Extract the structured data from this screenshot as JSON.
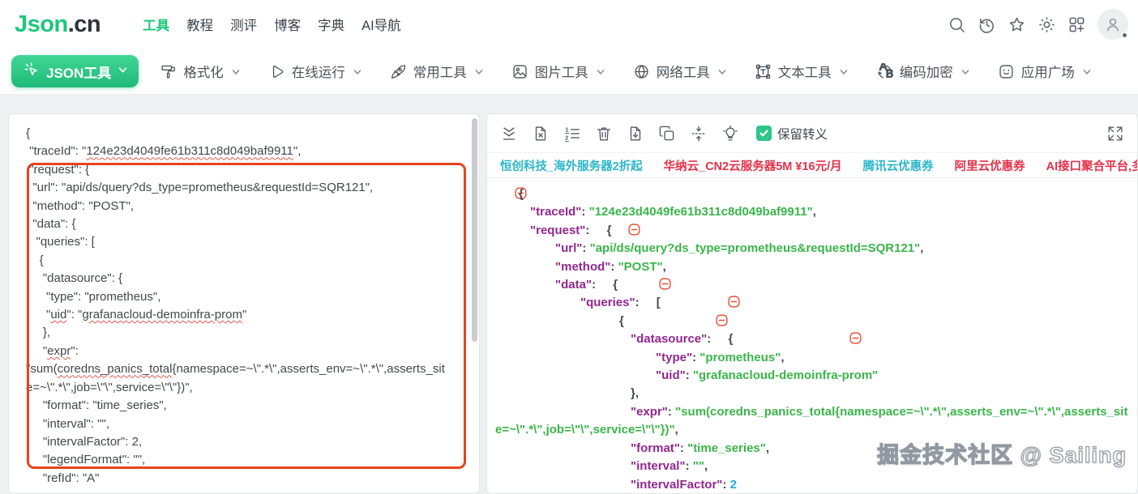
{
  "header": {
    "logo_part1": "Json",
    "logo_part2": ".cn",
    "nav": [
      {
        "label": "工具",
        "active": true
      },
      {
        "label": "教程",
        "active": false
      },
      {
        "label": "测评",
        "active": false
      },
      {
        "label": "博客",
        "active": false
      },
      {
        "label": "字典",
        "active": false
      },
      {
        "label": "AI导航",
        "active": false
      }
    ],
    "right_icons": [
      "search-icon",
      "history-icon",
      "favorite-icon",
      "theme-icon",
      "apps-icon"
    ]
  },
  "toolbar": {
    "primary_label": "JSON工具",
    "items": [
      {
        "label": "格式化",
        "icon": "format-icon"
      },
      {
        "label": "在线运行",
        "icon": "run-icon"
      },
      {
        "label": "常用工具",
        "icon": "rocket-icon"
      },
      {
        "label": "图片工具",
        "icon": "image-icon"
      },
      {
        "label": "网络工具",
        "icon": "globe-icon"
      },
      {
        "label": "文本工具",
        "icon": "text-icon"
      },
      {
        "label": "编码加密",
        "icon": "encode-icon"
      },
      {
        "label": "应用广场",
        "icon": "appstore-icon"
      }
    ]
  },
  "editor": {
    "lines": [
      [
        [
          "{",
          0
        ]
      ],
      [
        [
          " \"traceId\": \"",
          0
        ],
        [
          "124e23d4049fe61b311c8d049baf9911",
          1
        ],
        [
          "\",",
          0
        ]
      ],
      [
        [
          " \"request\": {",
          0
        ]
      ],
      [
        [
          "  \"url\": \"api/ds/query?ds_type=prometheus&requestId=SQR121\",",
          0
        ]
      ],
      [
        [
          "  \"method\": \"POST\",",
          0
        ]
      ],
      [
        [
          "  \"data\": {",
          0
        ]
      ],
      [
        [
          "   \"queries\": [",
          0
        ]
      ],
      [
        [
          "    {",
          0
        ]
      ],
      [
        [
          "     \"datasource\": {",
          0
        ]
      ],
      [
        [
          "      \"type\": \"prometheus\",",
          0
        ]
      ],
      [
        [
          "      \"",
          0
        ],
        [
          "uid",
          1
        ],
        [
          "\": \"",
          0
        ],
        [
          "grafanacloud-demoinfra-prom",
          1
        ],
        [
          "\"",
          0
        ]
      ],
      [
        [
          "     },",
          0
        ]
      ],
      [
        [
          "     \"",
          0
        ],
        [
          "expr",
          1
        ],
        [
          "\":",
          0
        ]
      ],
      [
        [
          "\"sum(",
          0
        ],
        [
          "coredns_panics_total",
          1
        ],
        [
          "{namespace=~\\\".*\\\",asserts_env=~\\\".*\\\",asserts_sit",
          0
        ]
      ],
      [
        [
          "e=~\\\".*\\\",job=\\\"\\\",service=\\\"\\\"})\",",
          0
        ]
      ],
      [
        [
          "     \"format\": \"time_series\",",
          0
        ]
      ],
      [
        [
          "     \"interval\": \"\",",
          0
        ]
      ],
      [
        [
          "     \"intervalFactor\": 2,",
          0
        ]
      ],
      [
        [
          "     \"legendFormat\": \"\",",
          0
        ]
      ],
      [
        [
          "     \"refId\": \"A\"",
          0
        ]
      ]
    ]
  },
  "output": {
    "toolbar_icons": [
      "collapse-all-icon",
      "file-remove-icon",
      "ordered-list-icon",
      "trash-icon",
      "file-download-icon",
      "copy-icon",
      "compress-icon",
      "tips-icon"
    ],
    "checkbox_label": "保留转义",
    "ads": [
      {
        "text": "恒创科技_海外服务器2折起",
        "color": "cyan"
      },
      {
        "text": "华纳云_CN2云服务器5M ¥16元/月",
        "color": "red"
      },
      {
        "text": "腾讯云优惠券",
        "color": "cyan"
      },
      {
        "text": "阿里云优惠券",
        "color": "red"
      },
      {
        "text": "AI接口聚合平台,多模型低至一折",
        "color": "red"
      }
    ],
    "tree": [
      {
        "i": 0,
        "t": [
          {
            "t": "c"
          },
          {
            "t": "p",
            "v": "{"
          }
        ]
      },
      {
        "i": 1,
        "t": [
          {
            "t": "k",
            "v": "\"traceId\""
          },
          {
            "t": "p",
            "v": ": "
          },
          {
            "t": "s",
            "v": "\"124e23d4049fe61b311c8d049baf9911\""
          },
          {
            "t": "p",
            "v": ","
          }
        ]
      },
      {
        "i": 1,
        "t": [
          {
            "t": "k",
            "v": "\"request\""
          },
          {
            "t": "p",
            "v": ": "
          },
          {
            "t": "c"
          },
          {
            "t": "p",
            "v": "{"
          }
        ]
      },
      {
        "i": 2,
        "t": [
          {
            "t": "k",
            "v": "\"url\""
          },
          {
            "t": "p",
            "v": ": "
          },
          {
            "t": "s",
            "v": "\"api/ds/query?ds_type=prometheus&requestId=SQR121\""
          },
          {
            "t": "p",
            "v": ","
          }
        ]
      },
      {
        "i": 2,
        "t": [
          {
            "t": "k",
            "v": "\"method\""
          },
          {
            "t": "p",
            "v": ": "
          },
          {
            "t": "s",
            "v": "\"POST\""
          },
          {
            "t": "p",
            "v": ","
          }
        ]
      },
      {
        "i": 2,
        "t": [
          {
            "t": "k",
            "v": "\"data\""
          },
          {
            "t": "p",
            "v": ": "
          },
          {
            "t": "c"
          },
          {
            "t": "p",
            "v": "{"
          }
        ]
      },
      {
        "i": 3,
        "t": [
          {
            "t": "k",
            "v": "\"queries\""
          },
          {
            "t": "p",
            "v": ": "
          },
          {
            "t": "c"
          },
          {
            "t": "p",
            "v": "["
          }
        ]
      },
      {
        "i": 4,
        "t": [
          {
            "t": "c"
          },
          {
            "t": "p",
            "v": "{"
          }
        ]
      },
      {
        "i": 5,
        "t": [
          {
            "t": "k",
            "v": "\"datasource\""
          },
          {
            "t": "p",
            "v": ": "
          },
          {
            "t": "c"
          },
          {
            "t": "p",
            "v": "{"
          }
        ]
      },
      {
        "i": 6,
        "t": [
          {
            "t": "k",
            "v": "\"type\""
          },
          {
            "t": "p",
            "v": ": "
          },
          {
            "t": "s",
            "v": "\"prometheus\""
          },
          {
            "t": "p",
            "v": ","
          }
        ]
      },
      {
        "i": 6,
        "t": [
          {
            "t": "k",
            "v": "\"uid\""
          },
          {
            "t": "p",
            "v": ": "
          },
          {
            "t": "s",
            "v": "\"grafanacloud-demoinfra-prom\""
          }
        ]
      },
      {
        "i": 5,
        "t": [
          {
            "t": "p",
            "v": "},"
          }
        ]
      },
      {
        "i": 5,
        "t": [
          {
            "t": "k",
            "v": "\"expr\""
          },
          {
            "t": "p",
            "v": ": "
          },
          {
            "t": "s",
            "v": "\"sum(coredns_panics_total{namespace=~\\\".*\\\",asserts_env=~\\\".*\\\",asserts_site=~\\\".*\\\",job=\\\"\\\",service=\\\"\\\"})\""
          },
          {
            "t": "p",
            "v": ","
          }
        ]
      },
      {
        "i": 5,
        "t": [
          {
            "t": "k",
            "v": "\"format\""
          },
          {
            "t": "p",
            "v": ": "
          },
          {
            "t": "s",
            "v": "\"time_series\""
          },
          {
            "t": "p",
            "v": ","
          }
        ]
      },
      {
        "i": 5,
        "t": [
          {
            "t": "k",
            "v": "\"interval\""
          },
          {
            "t": "p",
            "v": ": "
          },
          {
            "t": "s",
            "v": "\"\""
          },
          {
            "t": "p",
            "v": ","
          }
        ]
      },
      {
        "i": 5,
        "t": [
          {
            "t": "k",
            "v": "\"intervalFactor\""
          },
          {
            "t": "p",
            "v": ": "
          },
          {
            "t": "n",
            "v": "2"
          }
        ]
      }
    ]
  },
  "watermark": "掘金技术社区 @ Sailing",
  "colors": {
    "brand_green": "#1ec77c",
    "key_purple": "#92278f",
    "string_green": "#3ab54a",
    "number_blue": "#25aae2",
    "highlight_red": "#e8431f",
    "ad_cyan": "#2ab6c9",
    "ad_red": "#e23249"
  }
}
